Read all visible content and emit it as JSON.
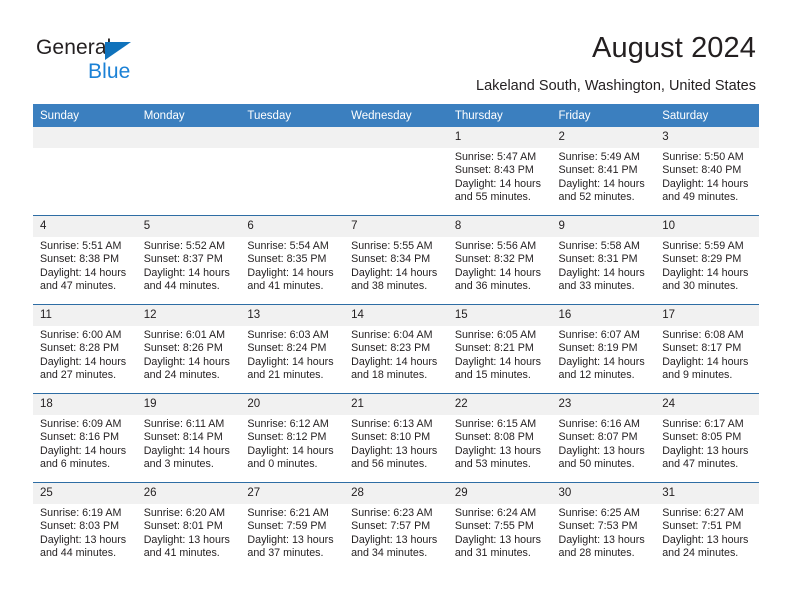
{
  "brand": {
    "name_top": "General",
    "name_bottom": "Blue",
    "triangle_icon": "blue-triangle-logo-icon",
    "color_dark": "#231f20",
    "color_blue": "#1b81d6"
  },
  "header": {
    "title": "August 2024",
    "subtitle": "Lakeland South, Washington, United States"
  },
  "theme": {
    "header_blue": "#3b7fbf",
    "row_divider_blue": "#2e6da4",
    "daynum_band": "#f1f1f1",
    "text": "#231f20"
  },
  "calendar": {
    "weekday_headers": [
      "Sunday",
      "Monday",
      "Tuesday",
      "Wednesday",
      "Thursday",
      "Friday",
      "Saturday"
    ],
    "labels": {
      "sunrise": "Sunrise:",
      "sunset": "Sunset:",
      "daylight": "Daylight:"
    },
    "weeks": [
      [
        {
          "blank": true
        },
        {
          "blank": true
        },
        {
          "blank": true
        },
        {
          "blank": true
        },
        {
          "day": "1",
          "sunrise": "Sunrise: 5:47 AM",
          "sunset": "Sunset: 8:43 PM",
          "daylight_1": "Daylight: 14 hours",
          "daylight_2": "and 55 minutes."
        },
        {
          "day": "2",
          "sunrise": "Sunrise: 5:49 AM",
          "sunset": "Sunset: 8:41 PM",
          "daylight_1": "Daylight: 14 hours",
          "daylight_2": "and 52 minutes."
        },
        {
          "day": "3",
          "sunrise": "Sunrise: 5:50 AM",
          "sunset": "Sunset: 8:40 PM",
          "daylight_1": "Daylight: 14 hours",
          "daylight_2": "and 49 minutes."
        }
      ],
      [
        {
          "day": "4",
          "sunrise": "Sunrise: 5:51 AM",
          "sunset": "Sunset: 8:38 PM",
          "daylight_1": "Daylight: 14 hours",
          "daylight_2": "and 47 minutes."
        },
        {
          "day": "5",
          "sunrise": "Sunrise: 5:52 AM",
          "sunset": "Sunset: 8:37 PM",
          "daylight_1": "Daylight: 14 hours",
          "daylight_2": "and 44 minutes."
        },
        {
          "day": "6",
          "sunrise": "Sunrise: 5:54 AM",
          "sunset": "Sunset: 8:35 PM",
          "daylight_1": "Daylight: 14 hours",
          "daylight_2": "and 41 minutes."
        },
        {
          "day": "7",
          "sunrise": "Sunrise: 5:55 AM",
          "sunset": "Sunset: 8:34 PM",
          "daylight_1": "Daylight: 14 hours",
          "daylight_2": "and 38 minutes."
        },
        {
          "day": "8",
          "sunrise": "Sunrise: 5:56 AM",
          "sunset": "Sunset: 8:32 PM",
          "daylight_1": "Daylight: 14 hours",
          "daylight_2": "and 36 minutes."
        },
        {
          "day": "9",
          "sunrise": "Sunrise: 5:58 AM",
          "sunset": "Sunset: 8:31 PM",
          "daylight_1": "Daylight: 14 hours",
          "daylight_2": "and 33 minutes."
        },
        {
          "day": "10",
          "sunrise": "Sunrise: 5:59 AM",
          "sunset": "Sunset: 8:29 PM",
          "daylight_1": "Daylight: 14 hours",
          "daylight_2": "and 30 minutes."
        }
      ],
      [
        {
          "day": "11",
          "sunrise": "Sunrise: 6:00 AM",
          "sunset": "Sunset: 8:28 PM",
          "daylight_1": "Daylight: 14 hours",
          "daylight_2": "and 27 minutes."
        },
        {
          "day": "12",
          "sunrise": "Sunrise: 6:01 AM",
          "sunset": "Sunset: 8:26 PM",
          "daylight_1": "Daylight: 14 hours",
          "daylight_2": "and 24 minutes."
        },
        {
          "day": "13",
          "sunrise": "Sunrise: 6:03 AM",
          "sunset": "Sunset: 8:24 PM",
          "daylight_1": "Daylight: 14 hours",
          "daylight_2": "and 21 minutes."
        },
        {
          "day": "14",
          "sunrise": "Sunrise: 6:04 AM",
          "sunset": "Sunset: 8:23 PM",
          "daylight_1": "Daylight: 14 hours",
          "daylight_2": "and 18 minutes."
        },
        {
          "day": "15",
          "sunrise": "Sunrise: 6:05 AM",
          "sunset": "Sunset: 8:21 PM",
          "daylight_1": "Daylight: 14 hours",
          "daylight_2": "and 15 minutes."
        },
        {
          "day": "16",
          "sunrise": "Sunrise: 6:07 AM",
          "sunset": "Sunset: 8:19 PM",
          "daylight_1": "Daylight: 14 hours",
          "daylight_2": "and 12 minutes."
        },
        {
          "day": "17",
          "sunrise": "Sunrise: 6:08 AM",
          "sunset": "Sunset: 8:17 PM",
          "daylight_1": "Daylight: 14 hours",
          "daylight_2": "and 9 minutes."
        }
      ],
      [
        {
          "day": "18",
          "sunrise": "Sunrise: 6:09 AM",
          "sunset": "Sunset: 8:16 PM",
          "daylight_1": "Daylight: 14 hours",
          "daylight_2": "and 6 minutes."
        },
        {
          "day": "19",
          "sunrise": "Sunrise: 6:11 AM",
          "sunset": "Sunset: 8:14 PM",
          "daylight_1": "Daylight: 14 hours",
          "daylight_2": "and 3 minutes."
        },
        {
          "day": "20",
          "sunrise": "Sunrise: 6:12 AM",
          "sunset": "Sunset: 8:12 PM",
          "daylight_1": "Daylight: 14 hours",
          "daylight_2": "and 0 minutes."
        },
        {
          "day": "21",
          "sunrise": "Sunrise: 6:13 AM",
          "sunset": "Sunset: 8:10 PM",
          "daylight_1": "Daylight: 13 hours",
          "daylight_2": "and 56 minutes."
        },
        {
          "day": "22",
          "sunrise": "Sunrise: 6:15 AM",
          "sunset": "Sunset: 8:08 PM",
          "daylight_1": "Daylight: 13 hours",
          "daylight_2": "and 53 minutes."
        },
        {
          "day": "23",
          "sunrise": "Sunrise: 6:16 AM",
          "sunset": "Sunset: 8:07 PM",
          "daylight_1": "Daylight: 13 hours",
          "daylight_2": "and 50 minutes."
        },
        {
          "day": "24",
          "sunrise": "Sunrise: 6:17 AM",
          "sunset": "Sunset: 8:05 PM",
          "daylight_1": "Daylight: 13 hours",
          "daylight_2": "and 47 minutes."
        }
      ],
      [
        {
          "day": "25",
          "sunrise": "Sunrise: 6:19 AM",
          "sunset": "Sunset: 8:03 PM",
          "daylight_1": "Daylight: 13 hours",
          "daylight_2": "and 44 minutes."
        },
        {
          "day": "26",
          "sunrise": "Sunrise: 6:20 AM",
          "sunset": "Sunset: 8:01 PM",
          "daylight_1": "Daylight: 13 hours",
          "daylight_2": "and 41 minutes."
        },
        {
          "day": "27",
          "sunrise": "Sunrise: 6:21 AM",
          "sunset": "Sunset: 7:59 PM",
          "daylight_1": "Daylight: 13 hours",
          "daylight_2": "and 37 minutes."
        },
        {
          "day": "28",
          "sunrise": "Sunrise: 6:23 AM",
          "sunset": "Sunset: 7:57 PM",
          "daylight_1": "Daylight: 13 hours",
          "daylight_2": "and 34 minutes."
        },
        {
          "day": "29",
          "sunrise": "Sunrise: 6:24 AM",
          "sunset": "Sunset: 7:55 PM",
          "daylight_1": "Daylight: 13 hours",
          "daylight_2": "and 31 minutes."
        },
        {
          "day": "30",
          "sunrise": "Sunrise: 6:25 AM",
          "sunset": "Sunset: 7:53 PM",
          "daylight_1": "Daylight: 13 hours",
          "daylight_2": "and 28 minutes."
        },
        {
          "day": "31",
          "sunrise": "Sunrise: 6:27 AM",
          "sunset": "Sunset: 7:51 PM",
          "daylight_1": "Daylight: 13 hours",
          "daylight_2": "and 24 minutes."
        }
      ]
    ]
  }
}
